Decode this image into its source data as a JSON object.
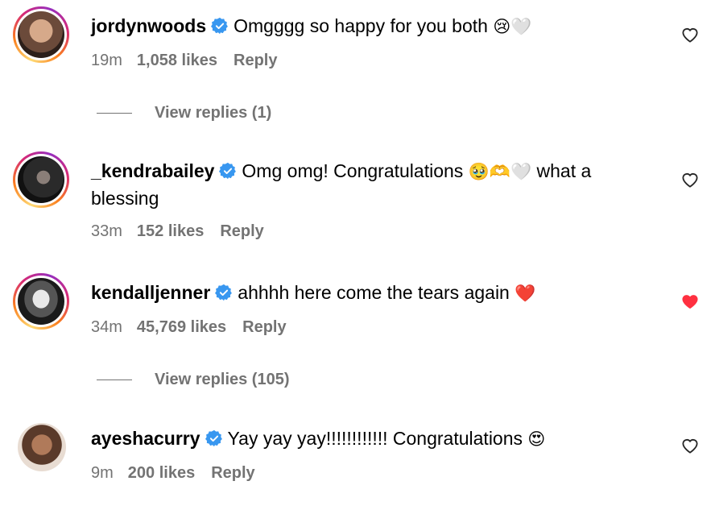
{
  "comments": [
    {
      "username": "jordynwoods",
      "text": "Omgggg so happy for you both",
      "emoji": "😢🤍",
      "time": "19m",
      "likes": "1,058 likes",
      "reply": "Reply",
      "liked": false
    },
    {
      "username": "_kendrabailey",
      "text": "Omg omg! Congratulations",
      "emoji": "🥹🫶🤍",
      "text2": "what a blessing",
      "time": "33m",
      "likes": "152 likes",
      "reply": "Reply",
      "liked": false
    },
    {
      "username": "kendalljenner",
      "text": "ahhhh here come the tears again",
      "emoji": "❤️",
      "time": "34m",
      "likes": "45,769 likes",
      "reply": "Reply",
      "liked": true
    },
    {
      "username": "ayeshacurry",
      "text": "Yay yay yay!!!!!!!!!!!! Congratulations",
      "emoji": "😍",
      "time": "9m",
      "likes": "200 likes",
      "reply": "Reply",
      "liked": false
    }
  ],
  "view_replies": [
    {
      "label": "View replies (1)"
    },
    {
      "label": "View replies (105)"
    }
  ],
  "colors": {
    "verified": "#3897f0",
    "liked_heart": "#ff3040",
    "meta_text": "#737373"
  },
  "icons": [
    "verified-badge-icon",
    "heart-outline-icon",
    "heart-filled-icon"
  ]
}
